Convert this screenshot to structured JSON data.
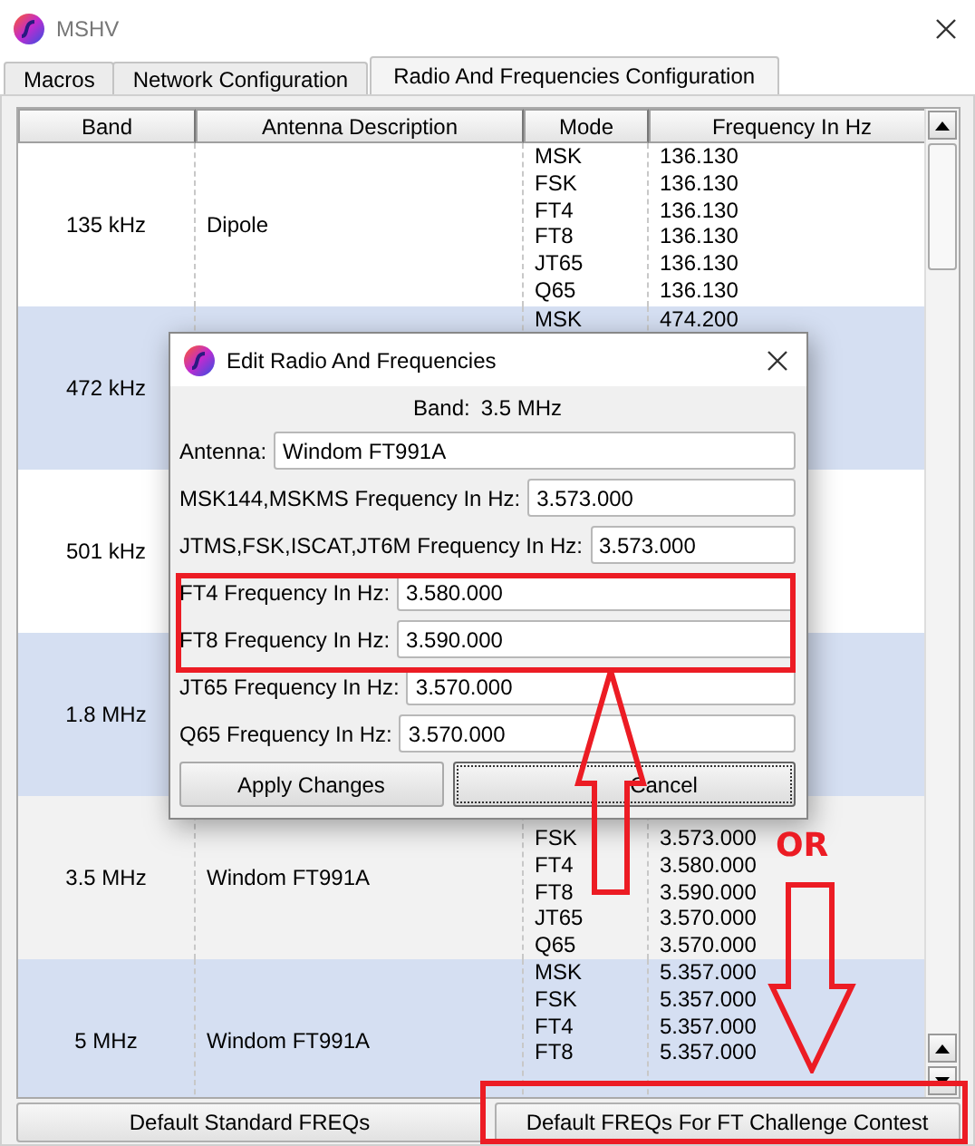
{
  "window": {
    "title": "MSHV"
  },
  "tabs": [
    {
      "label": "Macros",
      "selected": false
    },
    {
      "label": "Network Configuration",
      "selected": false
    },
    {
      "label": "Radio And Frequencies Configuration",
      "selected": true
    }
  ],
  "table": {
    "columns": [
      "Band",
      "Antenna Description",
      "Mode",
      "Frequency In Hz"
    ],
    "rows": [
      {
        "band": "135 kHz",
        "antenna": "Dipole",
        "selected": false,
        "modes": [
          {
            "mode": "MSK",
            "frequency": "136.130"
          },
          {
            "mode": "FSK",
            "frequency": "136.130"
          },
          {
            "mode": "FT4",
            "frequency": "136.130"
          },
          {
            "mode": "FT8",
            "frequency": "136.130"
          },
          {
            "mode": "JT65",
            "frequency": "136.130"
          },
          {
            "mode": "Q65",
            "frequency": "136.130"
          }
        ]
      },
      {
        "band": "472 kHz",
        "selected": false,
        "modes": [
          {
            "mode": "MSK",
            "frequency": "474.200"
          }
        ]
      },
      {
        "band": "501 kHz",
        "selected": false
      },
      {
        "band": "1.8 MHz",
        "selected": false
      },
      {
        "band": "3.5 MHz",
        "antenna": "Windom FT991A",
        "selected": true,
        "modes": [
          {
            "mode": "FSK",
            "frequency": "3.573.000"
          },
          {
            "mode": "FT4",
            "frequency": "3.580.000"
          },
          {
            "mode": "FT8",
            "frequency": "3.590.000"
          },
          {
            "mode": "JT65",
            "frequency": "3.570.000"
          },
          {
            "mode": "Q65",
            "frequency": "3.570.000"
          }
        ]
      },
      {
        "band": "5 MHz",
        "antenna": "Windom FT991A",
        "selected": false,
        "modes": [
          {
            "mode": "MSK",
            "frequency": "5.357.000"
          },
          {
            "mode": "FSK",
            "frequency": "5.357.000"
          },
          {
            "mode": "FT4",
            "frequency": "5.357.000"
          },
          {
            "mode": "FT8",
            "frequency": "5.357.000"
          }
        ]
      }
    ]
  },
  "buttons": [
    "Default Standard FREQs",
    "Default FREQs For FT Challenge Contest"
  ],
  "dialog": {
    "title": "Edit Radio And Frequencies",
    "band_label": "Band:",
    "band_value": "3.5 MHz",
    "fields": [
      {
        "label": "Antenna:",
        "value": "Windom FT991A"
      },
      {
        "label": "MSK144,MSKMS Frequency In Hz:",
        "value": "3.573.000"
      },
      {
        "label": "JTMS,FSK,ISCAT,JT6M Frequency In Hz:",
        "value": "3.573.000"
      },
      {
        "label": "FT4 Frequency In Hz:",
        "value": "3.580.000"
      },
      {
        "label": "FT8 Frequency In Hz:",
        "value": "3.590.000"
      },
      {
        "label": "JT65 Frequency In Hz:",
        "value": "3.570.000"
      },
      {
        "label": "Q65 Frequency In Hz:",
        "value": "3.570.000"
      }
    ],
    "buttons": [
      {
        "label": "Apply Changes",
        "focused": false
      },
      {
        "label": "Cancel",
        "focused": true
      }
    ]
  },
  "annotations": {
    "label": "OR"
  }
}
